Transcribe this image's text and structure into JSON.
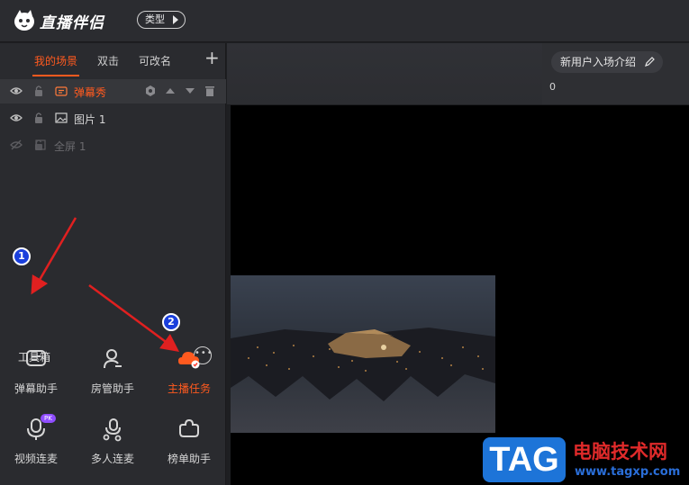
{
  "app": {
    "logo_text": "直播伴侣",
    "type_button": "类型"
  },
  "scene_tabs": [
    {
      "label": "我的场景",
      "active": true
    },
    {
      "label": "双击",
      "active": false
    },
    {
      "label": "可改名",
      "active": false
    }
  ],
  "layers": [
    {
      "name": "弹幕秀",
      "icon": "danmu-layer-icon",
      "selected": true
    },
    {
      "name": "图片 1",
      "icon": "image-layer-icon",
      "selected": false
    },
    {
      "name": "全屏 1",
      "icon": "fullscreen-layer-icon",
      "selected": false,
      "hidden": true
    }
  ],
  "toolbox": {
    "title": "工具箱",
    "tools": [
      {
        "label": "弹幕助手",
        "icon": "danmu-assistant-icon"
      },
      {
        "label": "房管助手",
        "icon": "room-manager-icon"
      },
      {
        "label": "主播任务",
        "icon": "anchor-task-icon",
        "active": true
      },
      {
        "label": "视频连麦",
        "icon": "video-link-icon",
        "badge": "PK"
      },
      {
        "label": "多人连麦",
        "icon": "multi-link-icon"
      },
      {
        "label": "榜单助手",
        "icon": "ranking-icon"
      }
    ]
  },
  "header": {
    "intro_button": "新用户入场介绍",
    "red_text": "新",
    "count": "0"
  },
  "annotations": {
    "step1": "1",
    "step2": "2"
  },
  "watermark": {
    "tag": "TAG",
    "site_name": "电脑技术网",
    "url": "www.tagxp.com"
  },
  "colors": {
    "accent": "#ff5a1f",
    "annotation_arrow": "#e02020",
    "badge_blue": "#1a3fdc"
  }
}
